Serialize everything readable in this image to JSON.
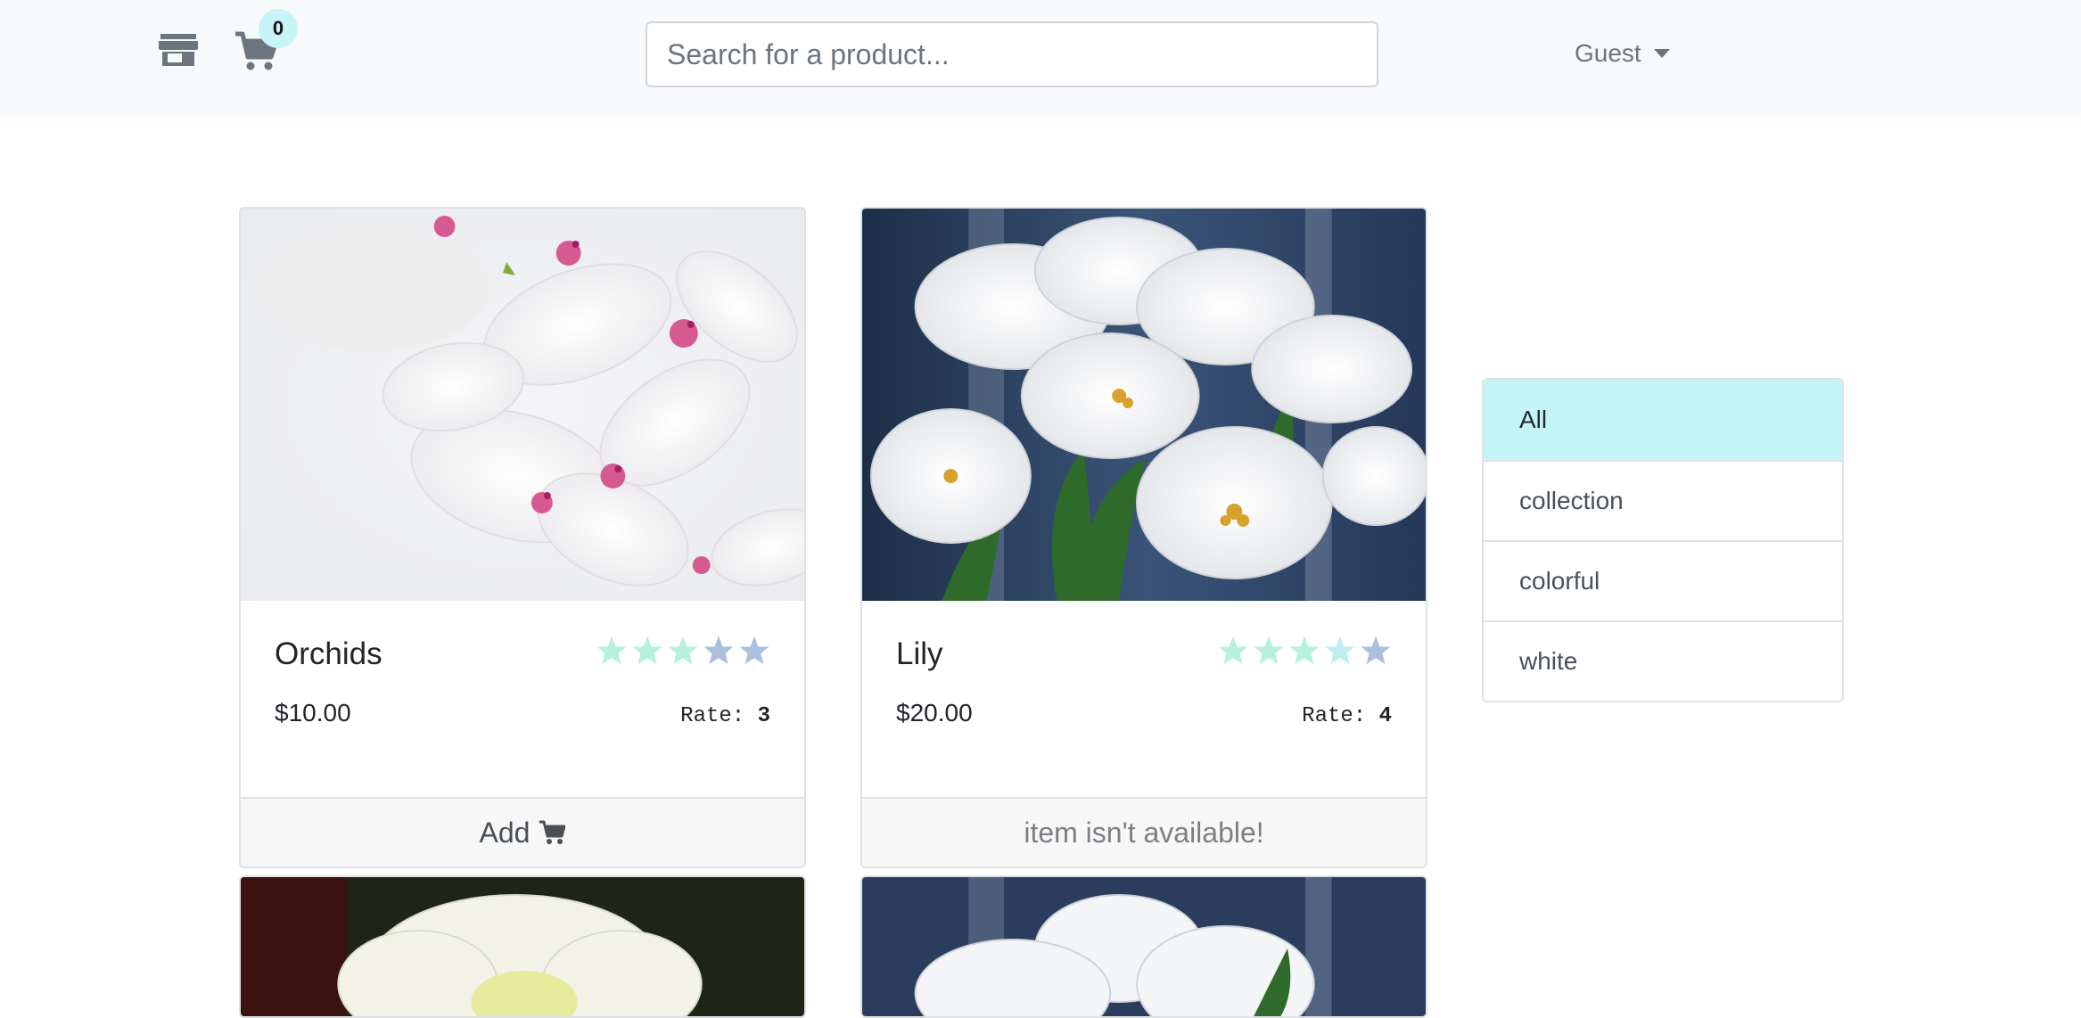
{
  "header": {
    "store_icon": "store-icon",
    "cart_icon": "cart-icon",
    "cart_count": "0",
    "search_placeholder": "Search for a product...",
    "user_label": "Guest"
  },
  "products": [
    {
      "name": "Orchids",
      "price": "$10.00",
      "rate_label": "Rate:",
      "rate": "3",
      "stars_filled": 3,
      "footer": "Add",
      "footer_icon": "shopping-cart-icon",
      "available": true
    },
    {
      "name": "Lily",
      "price": "$20.00",
      "rate_label": "Rate:",
      "rate": "4",
      "stars_filled": 4,
      "footer": "item isn't available!",
      "available": false
    }
  ],
  "categories": [
    {
      "label": "All",
      "active": true
    },
    {
      "label": "collection",
      "active": false
    },
    {
      "label": "colorful",
      "active": false
    },
    {
      "label": "white",
      "active": false
    }
  ],
  "colors": {
    "star_filled": "#b6f0de",
    "star_empty": "#aac0dd",
    "active_category": "#c5f4f7",
    "badge": "#c7f4f7"
  }
}
